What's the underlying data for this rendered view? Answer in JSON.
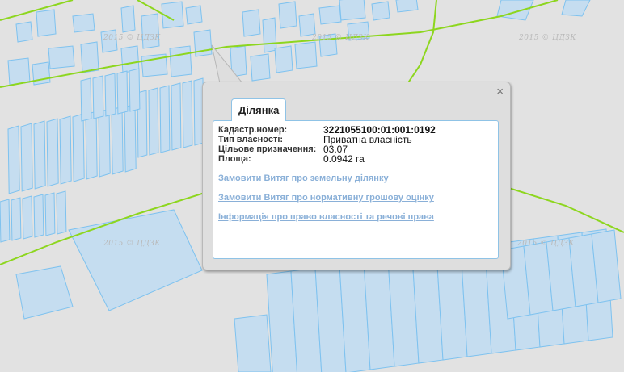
{
  "watermark": "2015 © ЦДЗК",
  "popup": {
    "tab_label": "Ділянка",
    "close_label": "×",
    "properties": [
      {
        "label": "Кадастр.номер:",
        "value": "3221055100:01:001:0192"
      },
      {
        "label": "Тип власності:",
        "value": "Приватна власність"
      },
      {
        "label": "Цільове призначення:",
        "value": "03.07"
      },
      {
        "label": "Площа:",
        "value": "0.0942 га"
      }
    ],
    "links": [
      "Замовити Витяг про земельну ділянку",
      "Замовити Витяг про нормативну грошову оцінку",
      "Інформація про право власності та речові права"
    ]
  },
  "colors": {
    "background": "#e2e2e2",
    "parcel_fill": "#c5ddf0",
    "parcel_stroke": "#7ec2ef",
    "boundary_line": "#8dd61e",
    "link": "#8ab0d8"
  }
}
